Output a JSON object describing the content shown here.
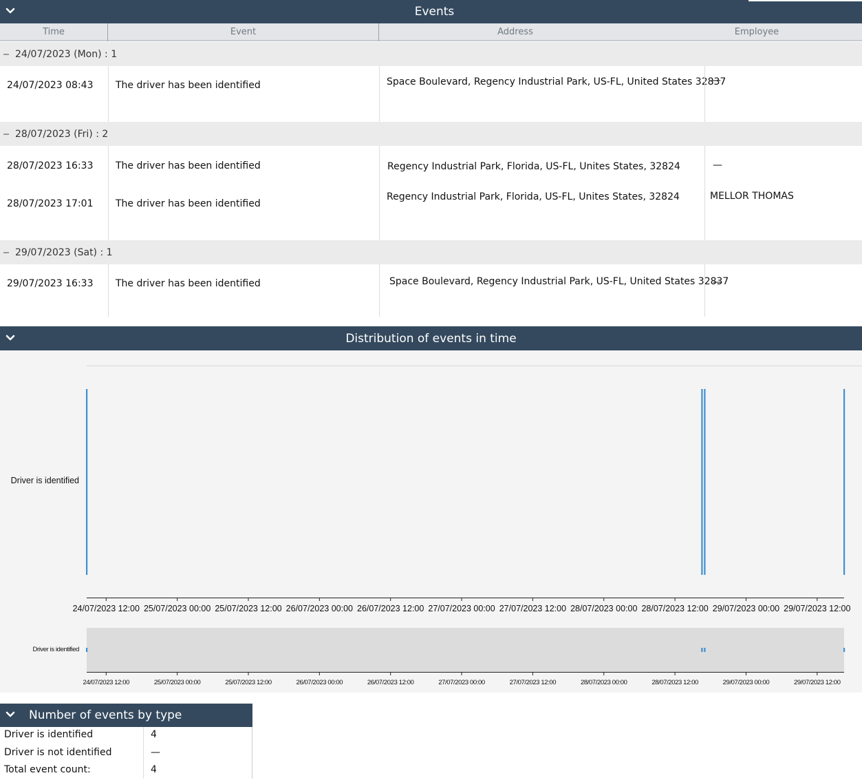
{
  "events_panel": {
    "title": "Events",
    "columns": [
      "Time",
      "Event",
      "Address",
      "Employee"
    ],
    "groups": [
      {
        "label": "24/07/2023 (Mon) : 1",
        "rows": [
          {
            "time": "24/07/2023 08:43",
            "event": "The driver has been identified",
            "address": "Space Boulevard, Regency Industrial Park, US-FL, United States 32837",
            "employee": "—"
          }
        ]
      },
      {
        "label": "28/07/2023 (Fri) : 2",
        "rows": [
          {
            "time": "28/07/2023 16:33",
            "event": "The driver has been identified",
            "address": "Regency Industrial Park, Florida, US-FL, Unites States, 32824",
            "employee": "—"
          },
          {
            "time": "28/07/2023 17:01",
            "event": "The driver has been identified",
            "address": "Regency Industrial Park, Florida, US-FL, Unites States, 32824",
            "employee": "MELLOR THOMAS"
          }
        ]
      },
      {
        "label": "29/07/2023 (Sat) : 1",
        "rows": [
          {
            "time": "29/07/2023 16:33",
            "event": "The driver has been identified",
            "address": "Space Boulevard, Regency Industrial Park, US-FL, United States 32837",
            "employee": "—"
          }
        ]
      }
    ]
  },
  "distribution_panel": {
    "title": "Distribution of events in time"
  },
  "chart_data": {
    "type": "scatter",
    "title": "Distribution of events in time",
    "series": [
      {
        "name": "Driver is identified",
        "x": [
          "24/07/2023 08:43",
          "28/07/2023 16:33",
          "28/07/2023 17:01",
          "29/07/2023 16:33"
        ]
      }
    ],
    "xlim": [
      "24/07/2023 08:43",
      "29/07/2023 16:33"
    ],
    "x_ticks": [
      "24/07/2023 12:00",
      "25/07/2023 00:00",
      "25/07/2023 12:00",
      "26/07/2023 00:00",
      "26/07/2023 12:00",
      "27/07/2023 00:00",
      "27/07/2023 12:00",
      "28/07/2023 00:00",
      "28/07/2023 12:00",
      "29/07/2023 00:00",
      "29/07/2023 12:00"
    ],
    "y_categories": [
      "Driver is identified"
    ],
    "bar_color": "#3d8fd1",
    "has_overview_navigator": true
  },
  "counts_panel": {
    "title": "Number of events by type",
    "rows": [
      {
        "label": "Driver is identified",
        "value": "4"
      },
      {
        "label": "Driver is not identified",
        "value": "—"
      },
      {
        "label": "Total event count:",
        "value": "4"
      }
    ]
  },
  "colors": {
    "header_bg": "#34495e",
    "group_bg": "#ebebeb",
    "chart_bg": "#f4f4f4",
    "overview_bg": "#dcdcdc",
    "accent": "#3d8fd1"
  }
}
